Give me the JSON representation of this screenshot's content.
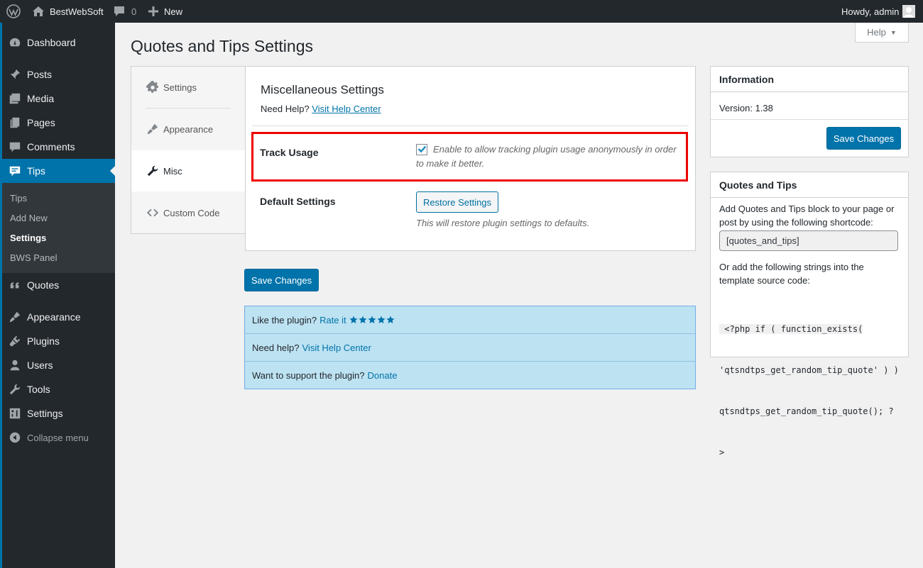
{
  "adminbar": {
    "site_name": "BestWebSoft",
    "comments_count": "0",
    "new_label": "New",
    "howdy": "Howdy, admin"
  },
  "sidebar": {
    "items": [
      {
        "label": "Dashboard",
        "icon": "dashboard-icon"
      },
      {
        "label": "Posts",
        "icon": "pin-icon"
      },
      {
        "label": "Media",
        "icon": "media-icon"
      },
      {
        "label": "Pages",
        "icon": "pages-icon"
      },
      {
        "label": "Comments",
        "icon": "comment-icon"
      },
      {
        "label": "Tips",
        "icon": "tips-icon"
      },
      {
        "label": "Quotes",
        "icon": "quote-icon"
      },
      {
        "label": "Appearance",
        "icon": "brush-icon"
      },
      {
        "label": "Plugins",
        "icon": "plugin-icon"
      },
      {
        "label": "Users",
        "icon": "user-icon"
      },
      {
        "label": "Tools",
        "icon": "wrench-icon"
      },
      {
        "label": "Settings",
        "icon": "settings-icon"
      },
      {
        "label": "Collapse menu",
        "icon": "collapse-icon"
      }
    ],
    "submenu": [
      "Tips",
      "Add New",
      "Settings",
      "BWS Panel"
    ],
    "current": "Tips",
    "current_sub": "Settings"
  },
  "help": {
    "label": "Help"
  },
  "page": {
    "title": "Quotes and Tips Settings"
  },
  "tabs": [
    {
      "label": "Settings",
      "icon": "gear-icon"
    },
    {
      "label": "Appearance",
      "icon": "brush-icon"
    },
    {
      "label": "Misc",
      "icon": "wrench-icon"
    },
    {
      "label": "Custom Code",
      "icon": "code-icon"
    }
  ],
  "active_tab": "Misc",
  "misc": {
    "heading": "Miscellaneous Settings",
    "need_help_prefix": "Need Help?",
    "help_link": "Visit Help Center",
    "track_usage_label": "Track Usage",
    "track_usage_checked": true,
    "track_usage_desc_line1": "Enable to allow tracking plugin usage anonymously in order",
    "track_usage_desc_line2": "to make it better.",
    "default_settings_label": "Default Settings",
    "restore_button": "Restore Settings",
    "restore_desc": "This will restore plugin settings to defaults."
  },
  "save_button": "Save Changes",
  "notice": {
    "rate_prefix": "Like the plugin?",
    "rate_link": "Rate it",
    "help_prefix": "Need help?",
    "help_link": "Visit Help Center",
    "donate_prefix": "Want to support the plugin?",
    "donate_link": "Donate"
  },
  "info_box": {
    "title": "Information",
    "version": "Version: 1.38",
    "save_button": "Save Changes"
  },
  "qt_box": {
    "title": "Quotes and Tips",
    "text1_line1": "Add Quotes and Tips block to your page or",
    "text1_line2": "post by using the following shortcode:",
    "shortcode": "[quotes_and_tips]",
    "text2_line1": "Or add the following strings into the",
    "text2_line2": "template source code:",
    "code_line1": " <?php if ( function_exists(",
    "code_line2": "'qtsndtps_get_random_tip_quote' ) )",
    "code_line3": "qtsndtps_get_random_tip_quote(); ?",
    "code_line4": ">"
  },
  "colors": {
    "accent": "#0073aa",
    "sidebar_bg": "#23282d",
    "highlight": "#e00000",
    "notice_bg": "#bde2f2"
  }
}
